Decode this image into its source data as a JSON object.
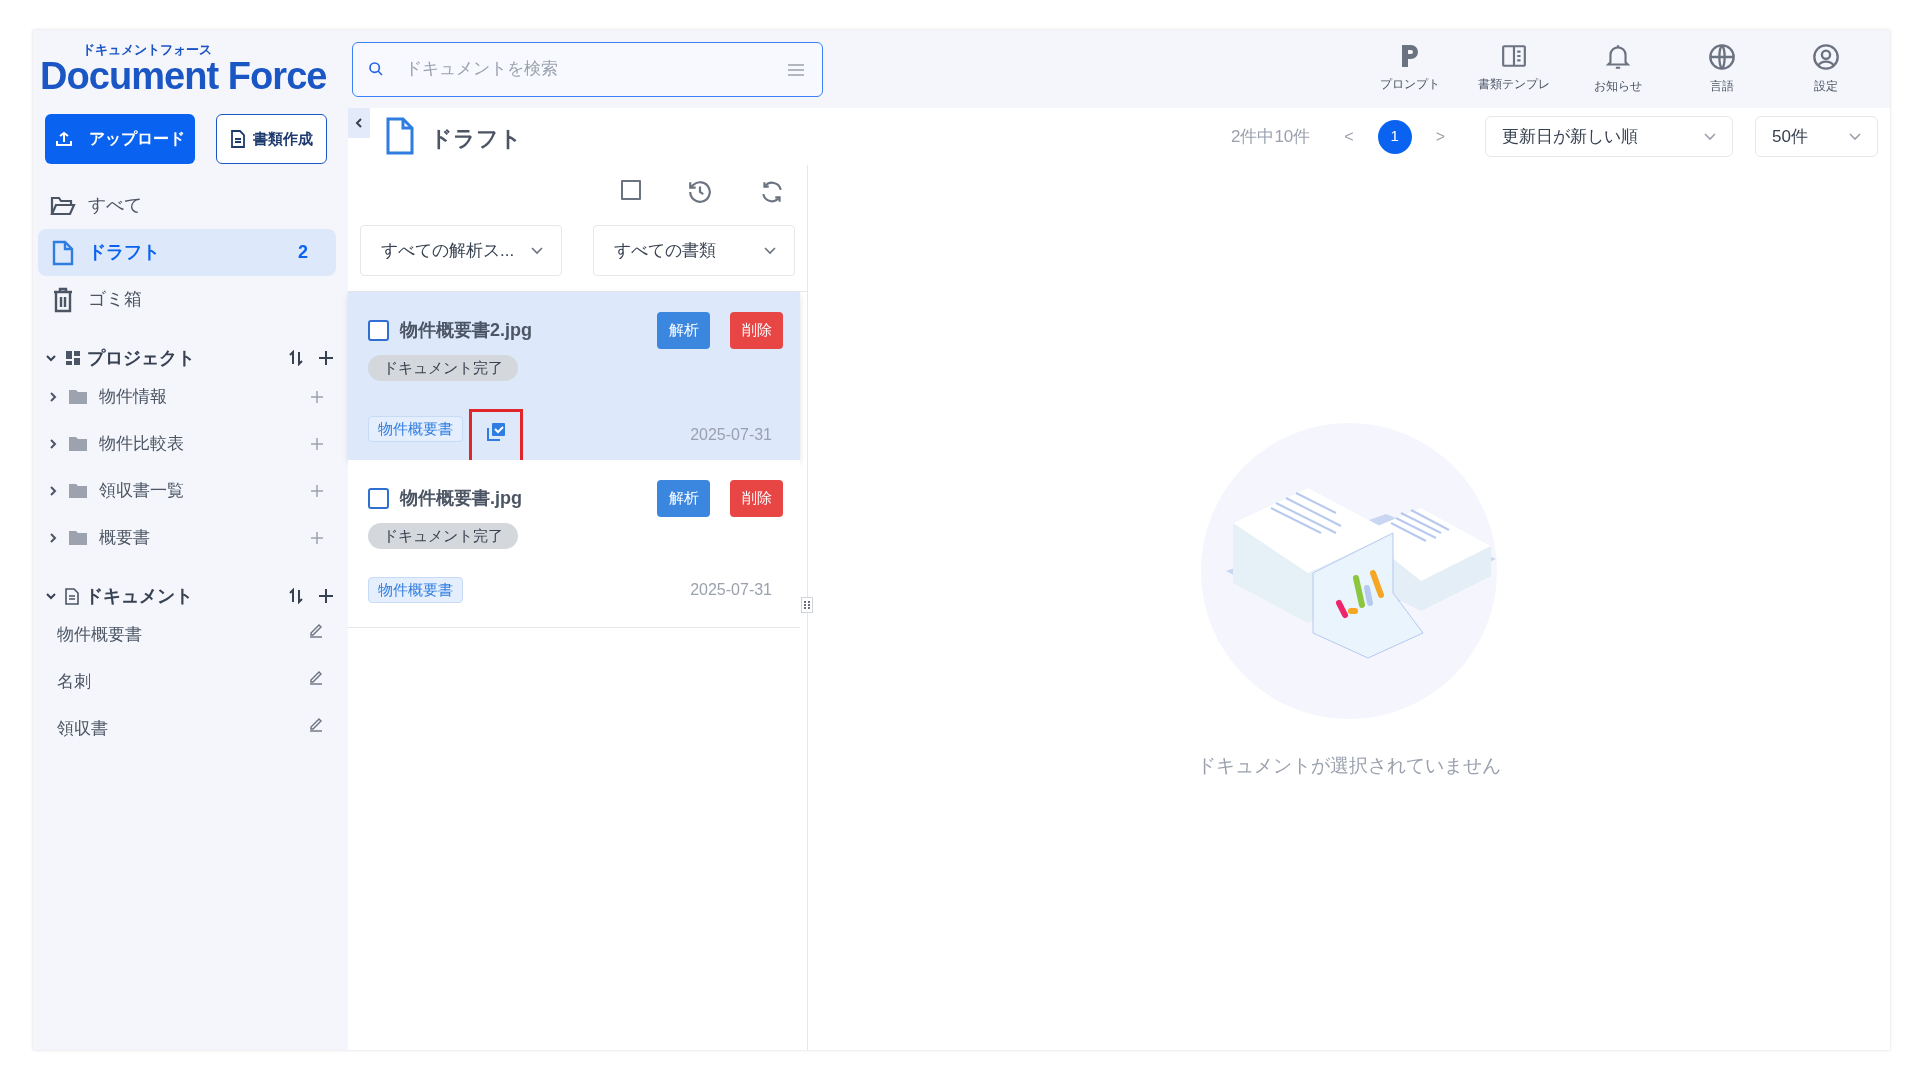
{
  "logo": {
    "subtitle": "ドキュメントフォース",
    "name": "Document Force"
  },
  "search": {
    "placeholder": "ドキュメントを検索"
  },
  "header_actions": [
    {
      "label": "プロンプト",
      "kind": "prompt"
    },
    {
      "label": "書類テンプレ",
      "kind": "template"
    },
    {
      "label": "お知らせ",
      "kind": "bell"
    },
    {
      "label": "言語",
      "kind": "globe"
    },
    {
      "label": "設定",
      "kind": "user"
    }
  ],
  "sidebar": {
    "upload": "アップロード",
    "create": "書類作成",
    "nav": [
      {
        "label": "すべて",
        "kind": "all",
        "selected": false
      },
      {
        "label": "ドラフト",
        "kind": "draft",
        "selected": true,
        "count": "2"
      },
      {
        "label": "ゴミ箱",
        "kind": "trash",
        "selected": false
      }
    ],
    "projects": {
      "title": "プロジェクト",
      "expanded": true,
      "items": [
        {
          "label": "物件情報",
          "expanded": false
        },
        {
          "label": "物件比較表",
          "expanded": false
        },
        {
          "label": "領収書一覧",
          "expanded": false
        },
        {
          "label": "概要書",
          "expanded": false
        }
      ]
    },
    "documents": {
      "title": "ドキュメント",
      "expanded": true,
      "items": [
        {
          "label": "物件概要書"
        },
        {
          "label": "名刺"
        },
        {
          "label": "領収書"
        }
      ]
    }
  },
  "list": {
    "title": "ドラフト",
    "select_all_checked": false,
    "filters": [
      "すべての解析ス...",
      "すべての書類"
    ],
    "cards": [
      {
        "name": "物件概要書2.jpg",
        "checked": false,
        "selected": true,
        "analyze": "解析",
        "delete": "削除",
        "status": "ドキュメント完了",
        "tag": "物件概要書",
        "linked": true,
        "date": "2025-07-31"
      },
      {
        "name": "物件概要書.jpg",
        "checked": false,
        "selected": false,
        "analyze": "解析",
        "delete": "削除",
        "status": "ドキュメント完了",
        "tag": "物件概要書",
        "linked": false,
        "date": "2025-07-31"
      }
    ]
  },
  "pager": {
    "summary": "2件中10件",
    "prev": "<",
    "pages": [
      {
        "label": "1",
        "selected": true
      }
    ],
    "next": ">",
    "sort": "更新日が新しい順",
    "per_page": "50件"
  },
  "empty": {
    "message": "ドキュメントが選択されていません"
  }
}
